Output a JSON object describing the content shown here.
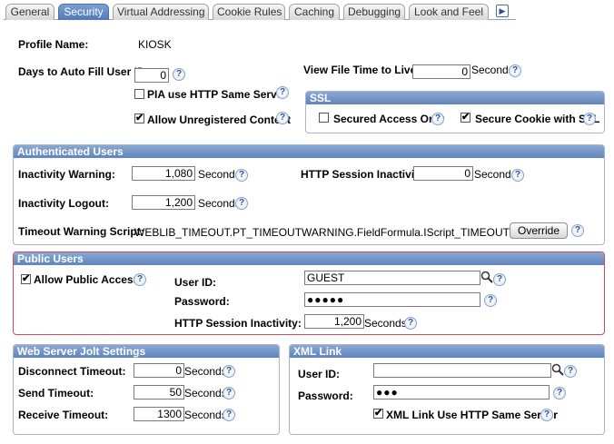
{
  "tabs": [
    {
      "label": "General"
    },
    {
      "label": "Security"
    },
    {
      "label": "Virtual Addressing"
    },
    {
      "label": "Cookie Rules"
    },
    {
      "label": "Caching"
    },
    {
      "label": "Debugging"
    },
    {
      "label": "Look and Feel"
    }
  ],
  "top": {
    "profile_name_label": "Profile Name:",
    "profile_name_value": "KIOSK",
    "days_auto_fill_label": "Days to Auto Fill User ID:",
    "days_auto_fill_value": "0",
    "view_file_time_label": "View File Time to Live:",
    "view_file_time_value": "0",
    "seconds": "Seconds",
    "pia_same_server_label": "PIA use HTTP Same Server",
    "allow_unregistered_label": "Allow Unregistered Content"
  },
  "ssl": {
    "title": "SSL",
    "secured_access_label": "Secured Access Only",
    "secure_cookie_label": "Secure Cookie with SSL"
  },
  "authenticated": {
    "title": "Authenticated Users",
    "inactivity_warning_label": "Inactivity Warning:",
    "inactivity_warning_value": "1,080",
    "inactivity_logout_label": "Inactivity Logout:",
    "inactivity_logout_value": "1,200",
    "http_session_label": "HTTP Session Inactivity:",
    "http_session_value": "0",
    "seconds": "Seconds",
    "timeout_script_label": "Timeout Warning Script:",
    "timeout_script_value": "WEBLIB_TIMEOUT.PT_TIMEOUTWARNING.FieldFormula.IScript_TIMEOUTWARNING",
    "override_label": "Override"
  },
  "public": {
    "title": "Public Users",
    "allow_public_label": "Allow Public Access",
    "user_id_label": "User ID:",
    "user_id_value": "GUEST",
    "password_label": "Password:",
    "password_value": "●●●●●",
    "http_session_label": "HTTP Session Inactivity:",
    "http_session_value": "1,200",
    "seconds": "Seconds"
  },
  "jolt": {
    "title": "Web Server Jolt Settings",
    "disconnect_label": "Disconnect Timeout:",
    "disconnect_value": "0",
    "send_label": "Send Timeout:",
    "send_value": "50",
    "receive_label": "Receive Timeout:",
    "receive_value": "1300",
    "seconds": "Seconds"
  },
  "xml": {
    "title": "XML Link",
    "user_id_label": "User ID:",
    "user_id_value": "",
    "password_label": "Password:",
    "password_value": "●●●",
    "same_server_label": "XML Link Use HTTP Same Server"
  },
  "icons": {
    "help": "?",
    "check": "✔",
    "scroll_right": "▶"
  }
}
